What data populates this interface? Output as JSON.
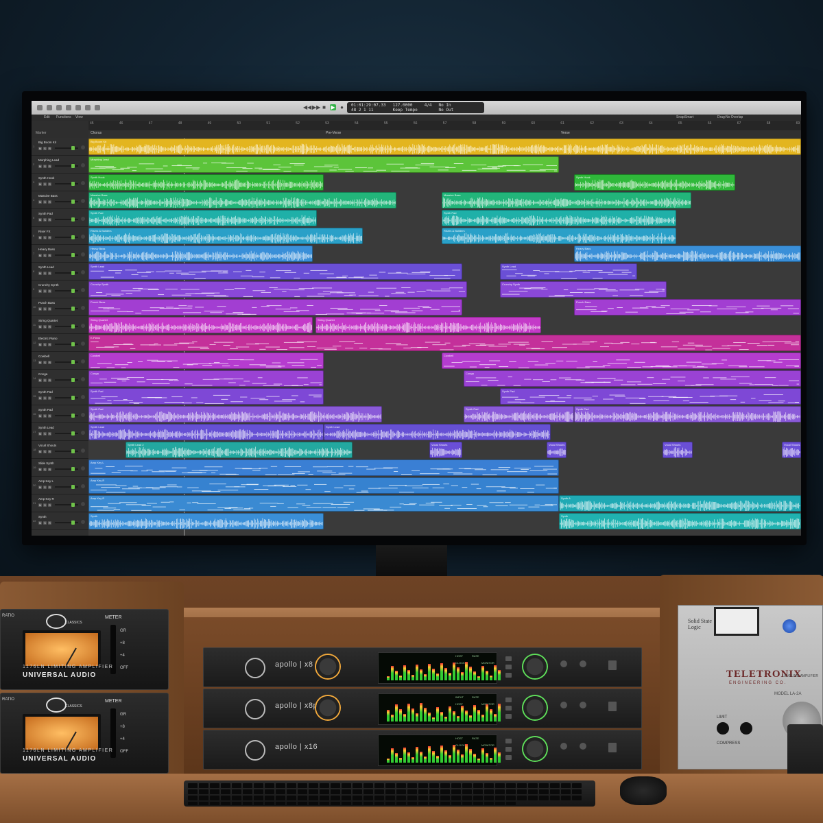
{
  "window": {
    "menu": [
      "Edit",
      "Functions",
      "View"
    ],
    "lcd": {
      "position": "01:01:29:07.33",
      "bars": "48  2  1  11",
      "tempo": "127.0000",
      "tempo_label": "Keep Tempo",
      "signature": "4/4",
      "in": "No In",
      "out": "No Out"
    },
    "snap_label": "Snap:",
    "snap_value": "Smart",
    "drag_label": "Drag:",
    "drag_value": "No Overlap"
  },
  "ruler": {
    "bars": [
      "45",
      "46",
      "47",
      "48",
      "49",
      "50",
      "51",
      "52",
      "53",
      "54",
      "55",
      "56",
      "57",
      "58",
      "59",
      "60",
      "61",
      "62",
      "63",
      "64",
      "65",
      "66",
      "67",
      "68",
      "69"
    ]
  },
  "markers": {
    "label": "Marker",
    "items": [
      "Chorus",
      "Pre-Verse",
      "Verse"
    ]
  },
  "tracks": [
    {
      "num": "1",
      "name": "Big Boom Kit"
    },
    {
      "num": "2",
      "name": "Morphing Lead"
    },
    {
      "num": "3",
      "name": "Synth Hook"
    },
    {
      "num": "4",
      "name": "Massive Bass"
    },
    {
      "num": "5",
      "name": "Synth Pad"
    },
    {
      "num": "6",
      "name": "Riser FX"
    },
    {
      "num": "7",
      "name": "Heavy Bass"
    },
    {
      "num": "8",
      "name": "Synth Lead"
    },
    {
      "num": "9",
      "name": "Crunchy Synth"
    },
    {
      "num": "10",
      "name": "Punch Bass"
    },
    {
      "num": "11",
      "name": "String Quartet"
    },
    {
      "num": "12",
      "name": "Electric Piano"
    },
    {
      "num": "13",
      "name": "Cowbell"
    },
    {
      "num": "14",
      "name": "Conga"
    },
    {
      "num": "15",
      "name": "Synth Pad"
    },
    {
      "num": "16",
      "name": "Synth Pad"
    },
    {
      "num": "17",
      "name": "Synth Lead"
    },
    {
      "num": "18",
      "name": "Vocal Shouts"
    },
    {
      "num": "19",
      "name": "Slide Synth"
    },
    {
      "num": "20",
      "name": "Amp Key L"
    },
    {
      "num": "21",
      "name": "Amp Key R"
    },
    {
      "num": "22",
      "name": "Synth"
    }
  ],
  "track_buttons": {
    "mute": "M",
    "solo": "S",
    "rec": "R"
  },
  "regions": [
    {
      "track": 0,
      "start": 0,
      "end": 1039,
      "color": "#e3b51f",
      "label": "Big Boom Kit",
      "wave": "audio"
    },
    {
      "track": 1,
      "start": 0,
      "end": 686,
      "color": "#5cc43a",
      "label": "Morphing Lead",
      "wave": "midi"
    },
    {
      "track": 2,
      "start": 0,
      "end": 343,
      "color": "#2fb83a",
      "label": "Synth Hook",
      "wave": "audio"
    },
    {
      "track": 2,
      "start": 708,
      "end": 943,
      "color": "#2fb83a",
      "label": "Synth Hook",
      "wave": "audio"
    },
    {
      "track": 3,
      "start": 0,
      "end": 449,
      "color": "#22b57a",
      "label": "Massive Bass",
      "wave": "audio"
    },
    {
      "track": 3,
      "start": 515,
      "end": 879,
      "color": "#22b57a",
      "label": "Massive Bass",
      "wave": "audio"
    },
    {
      "track": 4,
      "start": 0,
      "end": 333,
      "color": "#1fb0a8",
      "label": "Synth Pad",
      "wave": "audio"
    },
    {
      "track": 4,
      "start": 515,
      "end": 857,
      "color": "#1fb0a8",
      "label": "Synth Pad",
      "wave": "audio"
    },
    {
      "track": 5,
      "start": 0,
      "end": 400,
      "color": "#2aa0c8",
      "label": "Risers & Builders",
      "wave": "audio"
    },
    {
      "track": 5,
      "start": 515,
      "end": 857,
      "color": "#2aa0c8",
      "label": "Risers & Builders",
      "wave": "audio"
    },
    {
      "track": 6,
      "start": 0,
      "end": 327,
      "color": "#3a8fd8",
      "label": "Heavy Bass",
      "wave": "audio"
    },
    {
      "track": 6,
      "start": 708,
      "end": 1039,
      "color": "#3a8fd8",
      "label": "Heavy Bass",
      "wave": "audio"
    },
    {
      "track": 7,
      "start": 0,
      "end": 545,
      "color": "#6a4fd6",
      "label": "Synth Lead",
      "wave": "midi"
    },
    {
      "track": 7,
      "start": 600,
      "end": 800,
      "color": "#6a4fd6",
      "label": "Synth Lead",
      "wave": "midi"
    },
    {
      "track": 8,
      "start": 0,
      "end": 552,
      "color": "#8a48d8",
      "label": "Crunchy Synth",
      "wave": "midi"
    },
    {
      "track": 8,
      "start": 600,
      "end": 843,
      "color": "#8a48d8",
      "label": "Crunchy Synth",
      "wave": "midi"
    },
    {
      "track": 9,
      "start": 0,
      "end": 545,
      "color": "#a23ed2",
      "label": "Punch Bass",
      "wave": "midi"
    },
    {
      "track": 9,
      "start": 708,
      "end": 1039,
      "color": "#a23ed2",
      "label": "Punch Bass",
      "wave": "midi"
    },
    {
      "track": 10,
      "start": 0,
      "end": 327,
      "color": "#c43ac8",
      "label": "String Quartet",
      "wave": "audio"
    },
    {
      "track": 10,
      "start": 331,
      "end": 660,
      "color": "#c43ac8",
      "label": "String Quartet",
      "wave": "audio"
    },
    {
      "track": 11,
      "start": 0,
      "end": 1039,
      "color": "#c4309a",
      "label": "E-Piano",
      "wave": "midi"
    },
    {
      "track": 12,
      "start": 0,
      "end": 343,
      "color": "#b53ccf",
      "label": "Cowbell",
      "wave": "midi"
    },
    {
      "track": 12,
      "start": 515,
      "end": 1039,
      "color": "#b53ccf",
      "label": "Cowbell",
      "wave": "midi"
    },
    {
      "track": 13,
      "start": 0,
      "end": 343,
      "color": "#9a42d4",
      "label": "Conga",
      "wave": "midi"
    },
    {
      "track": 13,
      "start": 547,
      "end": 1039,
      "color": "#9a42d4",
      "label": "Conga",
      "wave": "midi"
    },
    {
      "track": 14,
      "start": 0,
      "end": 343,
      "color": "#7e48d6",
      "label": "Synth Pad",
      "wave": "midi"
    },
    {
      "track": 14,
      "start": 600,
      "end": 1039,
      "color": "#7e48d6",
      "label": "Synth Pad",
      "wave": "midi"
    },
    {
      "track": 15,
      "start": 0,
      "end": 428,
      "color": "#8a5ad8",
      "label": "Synth Pad",
      "wave": "audio"
    },
    {
      "track": 15,
      "start": 547,
      "end": 708,
      "color": "#8a5ad8",
      "label": "Synth Pad",
      "wave": "audio"
    },
    {
      "track": 15,
      "start": 708,
      "end": 1039,
      "color": "#8a5ad8",
      "label": "Synth Pad",
      "wave": "audio"
    },
    {
      "track": 16,
      "start": 0,
      "end": 343,
      "color": "#6650d4",
      "label": "Synth Lead",
      "wave": "audio"
    },
    {
      "track": 16,
      "start": 343,
      "end": 674,
      "color": "#6650d4",
      "label": "Synth Lead",
      "wave": "audio"
    },
    {
      "track": 17,
      "start": 54,
      "end": 385,
      "color": "#23a8a0",
      "label": "Synth Lead 2",
      "wave": "audio"
    },
    {
      "track": 17,
      "start": 497,
      "end": 545,
      "color": "#6a4fd6",
      "label": "Vocal Shouts",
      "wave": "audio"
    },
    {
      "track": 17,
      "start": 668,
      "end": 697,
      "color": "#6a4fd6",
      "label": "Vocal Shouts",
      "wave": "audio"
    },
    {
      "track": 17,
      "start": 837,
      "end": 881,
      "color": "#6a4fd6",
      "label": "Vocal Shouts",
      "wave": "audio"
    },
    {
      "track": 17,
      "start": 1011,
      "end": 1039,
      "color": "#6a4fd6",
      "label": "Vocal Shouts",
      "wave": "audio"
    },
    {
      "track": 18,
      "start": 0,
      "end": 686,
      "color": "#3a7fd4",
      "label": "Amp Key L",
      "wave": "midi"
    },
    {
      "track": 19,
      "start": 0,
      "end": 686,
      "color": "#3682d0",
      "label": "Amp Key R",
      "wave": "midi"
    },
    {
      "track": 20,
      "start": 0,
      "end": 686,
      "color": "#3a8ad2",
      "label": "Amp Key R",
      "wave": "midi"
    },
    {
      "track": 20,
      "start": 686,
      "end": 1039,
      "color": "#20a9b4",
      "label": "Synth A",
      "wave": "audio"
    },
    {
      "track": 21,
      "start": 0,
      "end": 343,
      "color": "#3a8fd8",
      "label": "Synth",
      "wave": "audio"
    },
    {
      "track": 21,
      "start": 686,
      "end": 1039,
      "color": "#20b2b0",
      "label": "Synth",
      "wave": "audio"
    }
  ],
  "playhead_pos": 0.134,
  "hardware": {
    "la_units": [
      {
        "classics": "CLASSICS",
        "meter": "METER",
        "ticks": [
          "GR",
          "+8",
          "+4",
          "OFF"
        ],
        "model": "1176LN LIMITING AMPLIFIER",
        "brand": "UNIVERSAL AUDIO",
        "ratio": "RATIO"
      },
      {
        "classics": "CLASSICS",
        "meter": "METER",
        "ticks": [
          "GR",
          "+8",
          "+4",
          "OFF"
        ],
        "model": "1176LN LIMITING AMPLIFIER",
        "brand": "UNIVERSAL AUDIO",
        "ratio": "RATIO"
      }
    ],
    "apollos": [
      {
        "name": "apollo | x8",
        "labels": [
          "HOST",
          "CLOCK",
          "RATE",
          "MONITOR"
        ]
      },
      {
        "name": "apollo | x8p",
        "labels": [
          "INPUT",
          "HOST",
          "RATE",
          "MONITOR"
        ]
      },
      {
        "name": "apollo | x16",
        "labels": [
          "HOST",
          "CLOCK",
          "RATE",
          "MONITOR"
        ]
      }
    ],
    "teletronix": {
      "solid": "Solid State Logic",
      "brand": "TELETRONIX",
      "engineering": "ENGINEERING CO.",
      "model": "MODEL LA-2A",
      "leveling": "LEVELING AMPLIFIER",
      "limit": "LIMIT",
      "compress": "COMPRESS"
    }
  }
}
